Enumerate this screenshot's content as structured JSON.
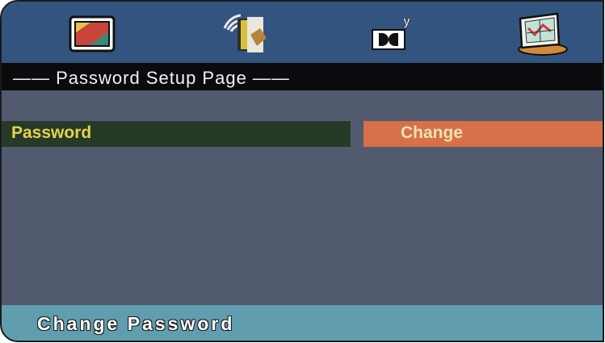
{
  "menu": {
    "icons": [
      {
        "icon": "general-setup-icon"
      },
      {
        "icon": "audio-setup-icon"
      },
      {
        "icon": "dolby-digital-icon",
        "glyph": "y"
      },
      {
        "icon": "preference-setup-icon"
      }
    ]
  },
  "page": {
    "title": "—— Password Setup Page ——"
  },
  "options": [
    {
      "label": "Password",
      "value": "Change"
    }
  ],
  "status": {
    "text": "Change Password"
  },
  "colors": {
    "icon_bar": "#33547f",
    "title_bar": "#0b0b0e",
    "panel": "#525a70",
    "row_selected": "#263a28",
    "label_text": "#e3d34c",
    "value_button": "#d8704a",
    "value_text": "#ede3b0",
    "status_bar": "#609eaf"
  }
}
